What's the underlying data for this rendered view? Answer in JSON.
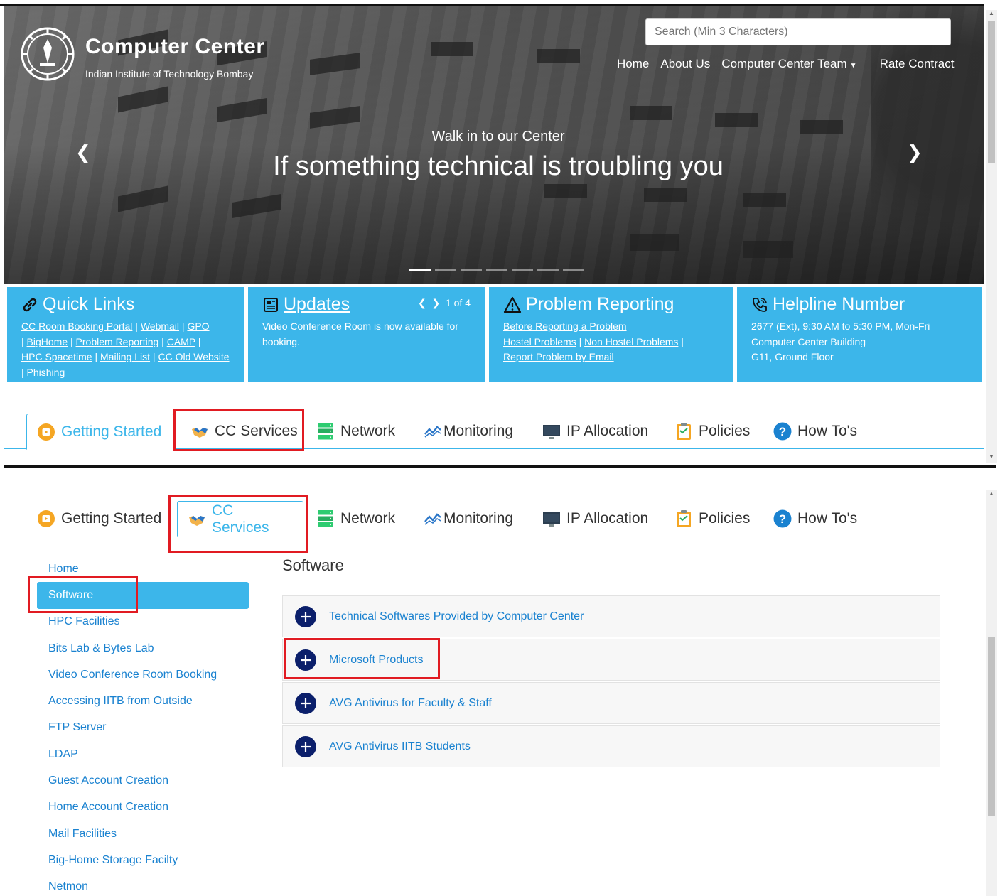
{
  "header": {
    "title": "Computer Center",
    "subtitle": "Indian Institute of Technology Bombay",
    "search_placeholder": "Search (Min 3 Characters)",
    "nav": [
      "Home",
      "About Us",
      "Computer Center Team",
      "Rate Contract"
    ]
  },
  "hero": {
    "small_text": "Walk in to our Center",
    "big_text": "If something technical is troubling you",
    "slide_count": 7,
    "active_slide": 1
  },
  "panels": {
    "quick_links": {
      "title": "Quick Links",
      "links": [
        "CC Room Booking Portal",
        "Webmail",
        "GPO",
        "BigHome",
        "Problem Reporting",
        "CAMP",
        "HPC Spacetime",
        "Mailing List",
        "CC Old Website",
        "Phishing"
      ]
    },
    "updates": {
      "title": "Updates",
      "pager": "1 of 4",
      "text": "Video Conference Room is now available for booking."
    },
    "problem_reporting": {
      "title": "Problem Reporting",
      "links": [
        "Before Reporting a Problem",
        "Hostel Problems",
        "Non Hostel Problems",
        "Report Problem by Email"
      ]
    },
    "helpline": {
      "title": "Helpline Number",
      "line1": "2677 (Ext), 9:30 AM to 5:30 PM, Mon-Fri",
      "line2": "Computer Center Building",
      "line3": "G11, Ground Floor"
    }
  },
  "tabs": [
    "Getting Started",
    "CC Services",
    "Network",
    "Monitoring",
    "IP Allocation",
    "Policies",
    "How To's"
  ],
  "sidebar": {
    "items": [
      "Home",
      "Software",
      "HPC Facilities",
      "Bits Lab & Bytes Lab",
      "Video Conference Room Booking",
      "Accessing IITB from Outside",
      "FTP Server",
      "LDAP",
      "Guest Account Creation",
      "Home Account Creation",
      "Mail Facilities",
      "Big-Home Storage Facilty",
      "Netmon"
    ],
    "active_index": 1
  },
  "content": {
    "title": "Software",
    "accordion": [
      "Technical Softwares Provided by Computer Center",
      "Microsoft Products",
      "AVG Antivirus for Faculty & Staff",
      "AVG Antivirus IITB Students"
    ]
  },
  "colors": {
    "accent": "#3cb6ea",
    "link": "#1a82d0",
    "highlight": "#e11b22",
    "plus_icon": "#0b1f6b"
  }
}
